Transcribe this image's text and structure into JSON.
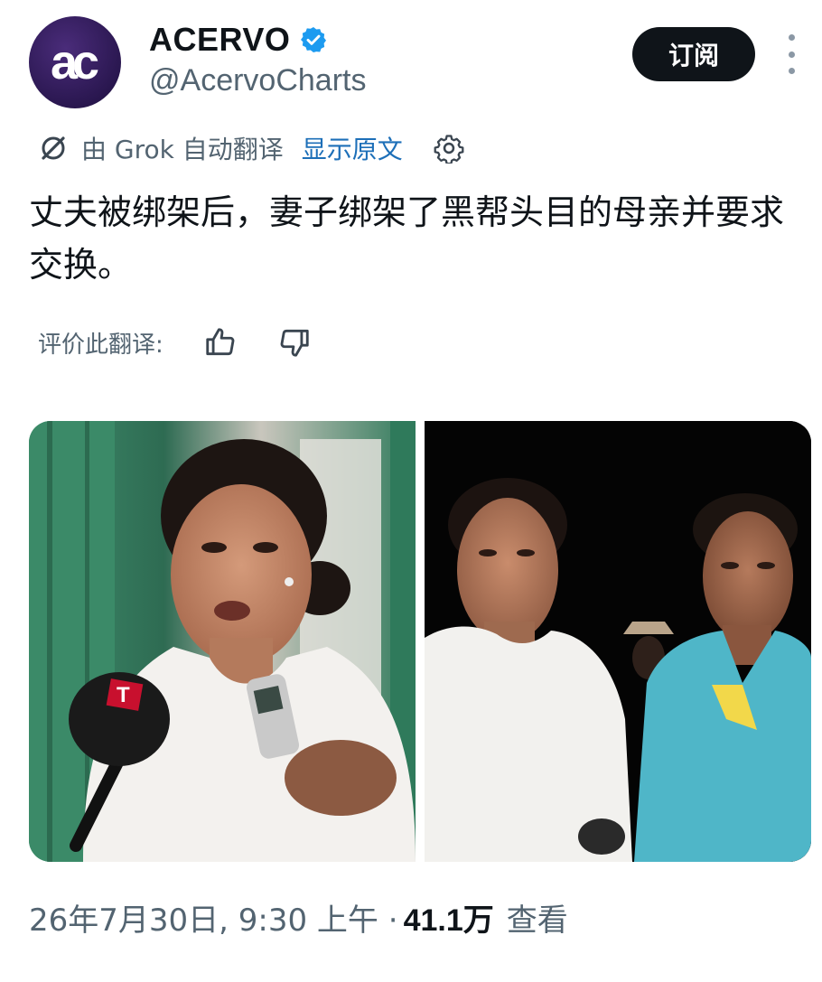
{
  "account": {
    "avatar_text": "ac",
    "display_name": "ACERVO",
    "handle": "@AcervoCharts",
    "verified": true
  },
  "subscribe_label": "订阅",
  "translation": {
    "text": "由 Grok 自动翻译",
    "show_original": "显示原文"
  },
  "tweet": {
    "text": "丈夫被绑架后，妻子绑架了黑帮头目的母亲并要求交换。"
  },
  "rating": {
    "label": "评价此翻译:"
  },
  "meta": {
    "timestamp": "26年7月30日, 9:30 上午 · ",
    "views": "41.1万",
    "views_label": "查看"
  },
  "colors": {
    "text": "#0f1419",
    "secondary": "#536471",
    "link": "#1d6fb8",
    "verified": "#1d9bf0",
    "button_bg": "#0f1419"
  },
  "icons": [
    "more-icon",
    "grok-icon",
    "gear-icon",
    "verified-badge-icon",
    "thumbs-up-icon",
    "thumbs-down-icon"
  ]
}
